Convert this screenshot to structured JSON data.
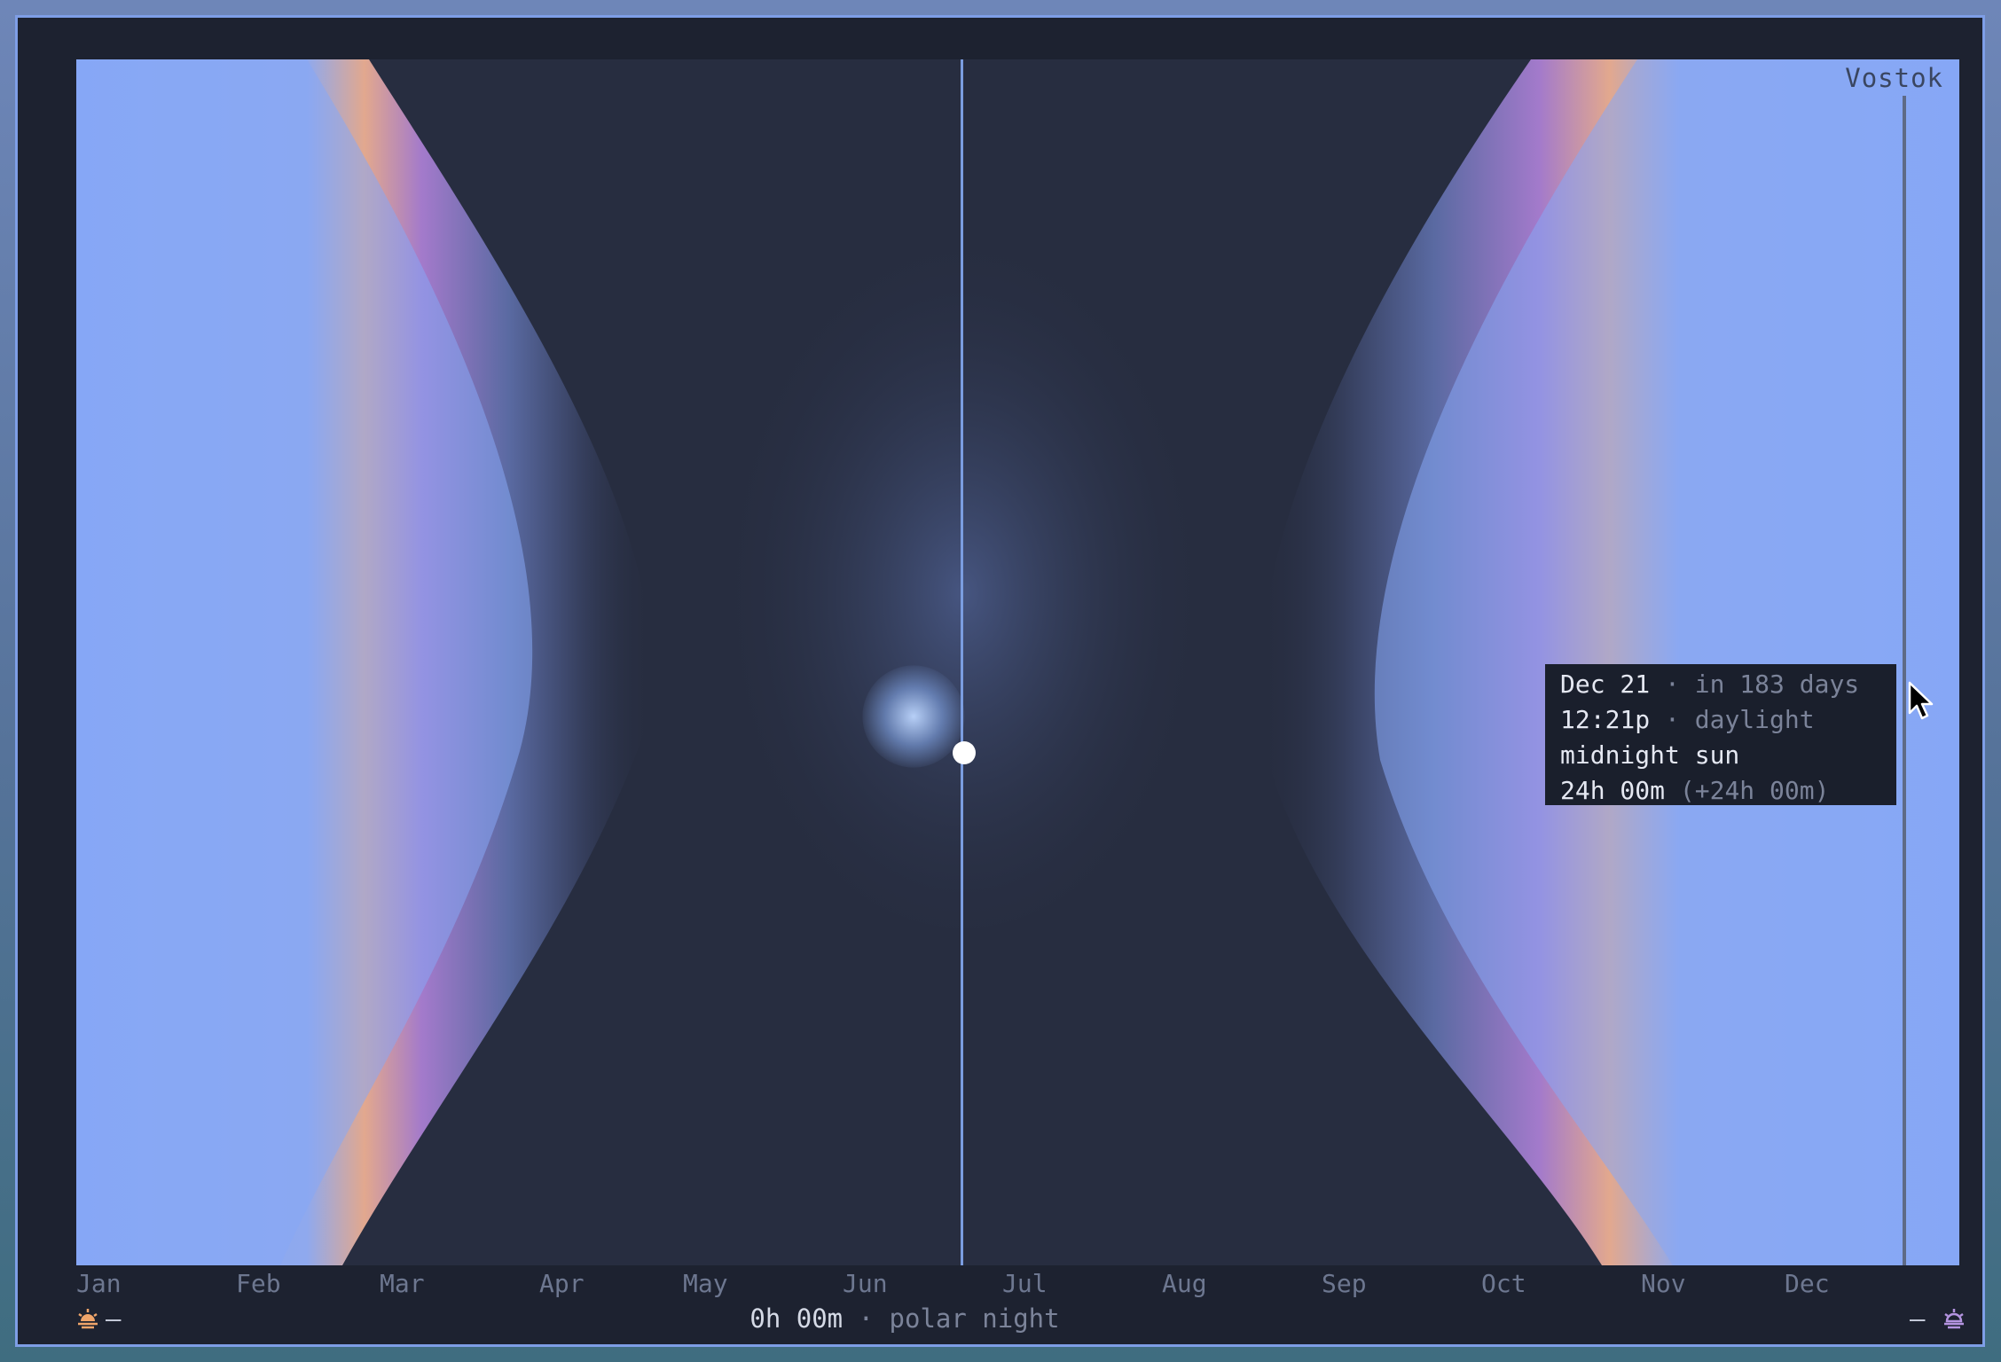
{
  "location": "Vostok",
  "months": [
    "Jan",
    "Feb",
    "Mar",
    "Apr",
    "May",
    "Jun",
    "Jul",
    "Aug",
    "Sep",
    "Oct",
    "Nov",
    "Dec"
  ],
  "tooltip": {
    "date": "Dec 21",
    "date_note": "· in 183 days",
    "time": "12:21p",
    "time_note": "· daylight",
    "condition": "midnight sun",
    "duration": "24h 00m",
    "duration_delta": "(+24h 00m)"
  },
  "footer": {
    "sunrise_value": "—",
    "sunset_value": "—",
    "day_length": "0h 00m",
    "separator": "·",
    "day_state": "polar night"
  },
  "icons": {
    "sunrise": "sunrise-icon",
    "sunset": "sunset-icon",
    "cursor": "mouse-pointer-icon"
  },
  "colors": {
    "day": "#86a7f5",
    "twilight_orange": "#e2a88e",
    "twilight_purple": "#a37acb",
    "night": "#272d40",
    "sun": "#ffffff",
    "today_line": "#7b9de0",
    "sunrise_icon": "#f0a56a",
    "sunset_icon": "#b494e0"
  }
}
